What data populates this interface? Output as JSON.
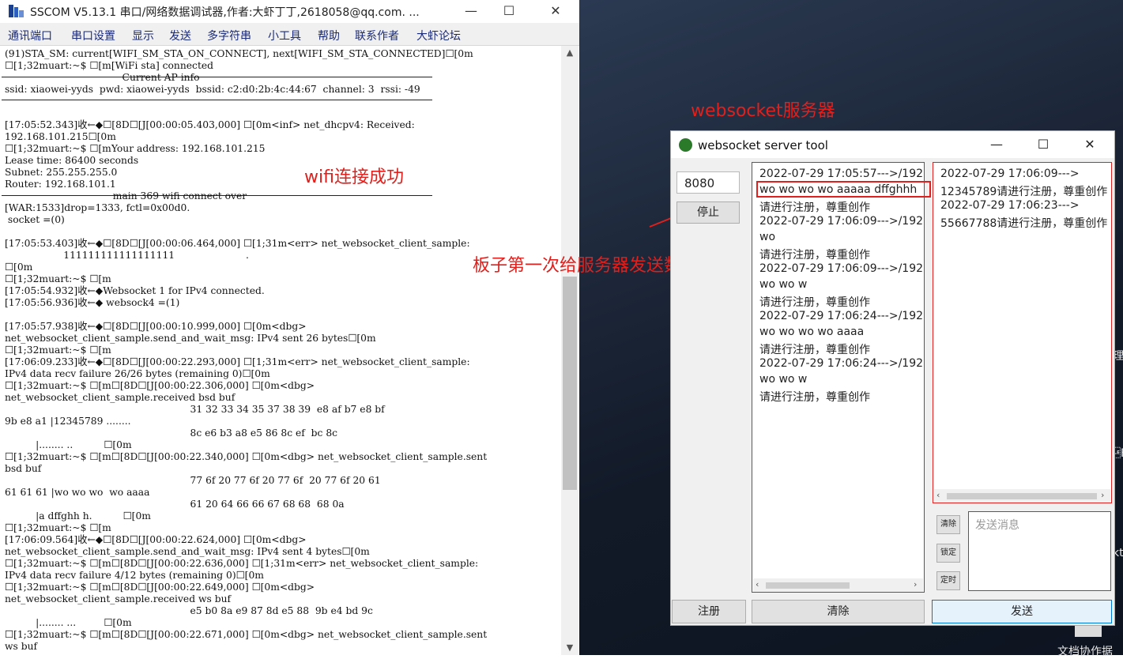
{
  "sscom": {
    "title": "SSCOM V5.13.1 串口/网络数据调试器,作者:大虾丁丁,2618058@qq.com. ...",
    "menu": [
      "通讯端口",
      "串口设置",
      "显示",
      "发送",
      "多字符串",
      "小工具",
      "帮助",
      "联系作者",
      "大虾论坛"
    ],
    "terminal_lines": [
      "(91)STA_SM: current[WIFI_SM_STA_ON_CONNECT], next[WIFI_SM_STA_CONNECTED]☐[0m",
      "☐[1;32muart:~$ ☐[m[WiFi sta] connected",
      "                                      Current AP info",
      "ssid: xiaowei-yyds  pwd: xiaowei-yyds  bssid: c2:d0:2b:4c:44:67  channel: 3  rssi: -49",
      "",
      "",
      "[17:05:52.343]收←◆☐[8D☐[J[00:00:05.403,000] ☐[0m<inf> net_dhcpv4: Received:",
      "192.168.101.215☐[0m",
      "☐[1;32muart:~$ ☐[mYour address: 192.168.101.215",
      "Lease time: 86400 seconds",
      "Subnet: 255.255.255.0",
      "Router: 192.168.101.1",
      "                                   main 369 wifi connect over",
      "[WAR:1533]drop=1333, fctl=0x00d0.",
      " socket =(0)",
      "",
      "[17:05:53.403]收←◆☐[8D☐[J[00:00:06.464,000] ☐[1;31m<err> net_websocket_client_sample:",
      "                   111111111111111111                       .",
      "☐[0m",
      "☐[1;32muart:~$ ☐[m",
      "[17:05:54.932]收←◆Websocket 1 for IPv4 connected.",
      "[17:05:56.936]收←◆ websock4 =(1)",
      "",
      "[17:05:57.938]收←◆☐[8D☐[J[00:00:10.999,000] ☐[0m<dbg>",
      "net_websocket_client_sample.send_and_wait_msg: IPv4 sent 26 bytes☐[0m",
      "☐[1;32muart:~$ ☐[m",
      "[17:06:09.233]收←◆☐[8D☐[J[00:00:22.293,000] ☐[1;31m<err> net_websocket_client_sample:",
      "IPv4 data recv failure 26/26 bytes (remaining 0)☐[0m",
      "☐[1;32muart:~$ ☐[m☐[8D☐[J[00:00:22.306,000] ☐[0m<dbg>",
      "net_websocket_client_sample.received bsd buf",
      "                                                            31 32 33 34 35 37 38 39  e8 af b7 e8 bf",
      "9b e8 a1 |12345789 ........",
      "                                                            8c e6 b3 a8 e5 86 8c ef  bc 8c",
      "          |........ ..          ☐[0m",
      "☐[1;32muart:~$ ☐[m☐[8D☐[J[00:00:22.340,000] ☐[0m<dbg> net_websocket_client_sample.sent",
      "bsd buf",
      "                                                            77 6f 20 77 6f 20 77 6f  20 77 6f 20 61",
      "61 61 61 |wo wo wo  wo aaaa",
      "                                                            61 20 64 66 66 67 68 68  68 0a",
      "          |a dffghh h.          ☐[0m",
      "☐[1;32muart:~$ ☐[m",
      "[17:06:09.564]收←◆☐[8D☐[J[00:00:22.624,000] ☐[0m<dbg>",
      "net_websocket_client_sample.send_and_wait_msg: IPv4 sent 4 bytes☐[0m",
      "☐[1;32muart:~$ ☐[m☐[8D☐[J[00:00:22.636,000] ☐[1;31m<err> net_websocket_client_sample:",
      "IPv4 data recv failure 4/12 bytes (remaining 0)☐[0m",
      "☐[1;32muart:~$ ☐[m☐[8D☐[J[00:00:22.649,000] ☐[0m<dbg>",
      "net_websocket_client_sample.received ws buf",
      "                                                            e5 b0 8a e9 87 8d e5 88  9b e4 bd 9c",
      "          |........ ...         ☐[0m",
      "☐[1;32muart:~$ ☐[m☐[8D☐[J[00:00:22.671,000] ☐[0m<dbg> net_websocket_client_sample.sent",
      "ws buf"
    ]
  },
  "annotations": {
    "wifi_ok": "wifi连接成功",
    "ws_server": "websocket服务器",
    "first_send": "板子第一次给服务器发送数据"
  },
  "ws": {
    "title": "websocket server tool",
    "port": "8080",
    "stop_label": "停止",
    "register_label": "注册",
    "clear_label": "清除",
    "send_label": "发送",
    "small_clear": "清除",
    "small_lock": "锁定",
    "small_timer": "定时",
    "send_placeholder": "发送消息",
    "messages": [
      "2022-07-29 17:05:57--->/192",
      "wo wo wo wo aaaaa dffghhh",
      "请进行注册，尊重创作",
      "2022-07-29 17:06:09--->/192",
      "wo",
      "请进行注册，尊重创作",
      "2022-07-29 17:06:09--->/192",
      "wo wo w",
      "请进行注册，尊重创作",
      "2022-07-29 17:06:24--->/192",
      "wo wo wo wo aaaa",
      "请进行注册，尊重创作",
      "2022-07-29 17:06:24--->/192",
      "wo wo w",
      "请进行注册，尊重创作"
    ],
    "clients": [
      "2022-07-29 17:06:09--->",
      "12345789请进行注册，尊重创作",
      "2022-07-29 17:06:23--->",
      "55667788请进行注册，尊重创作"
    ]
  },
  "desktop": {
    "hint_a": "理",
    "hint_b": "\u0010F.",
    "hint_c": "kt",
    "hint_d": "文档协作据"
  },
  "colors": {
    "annotation": "#e0201c",
    "menu_text": "#1a2a7a"
  }
}
